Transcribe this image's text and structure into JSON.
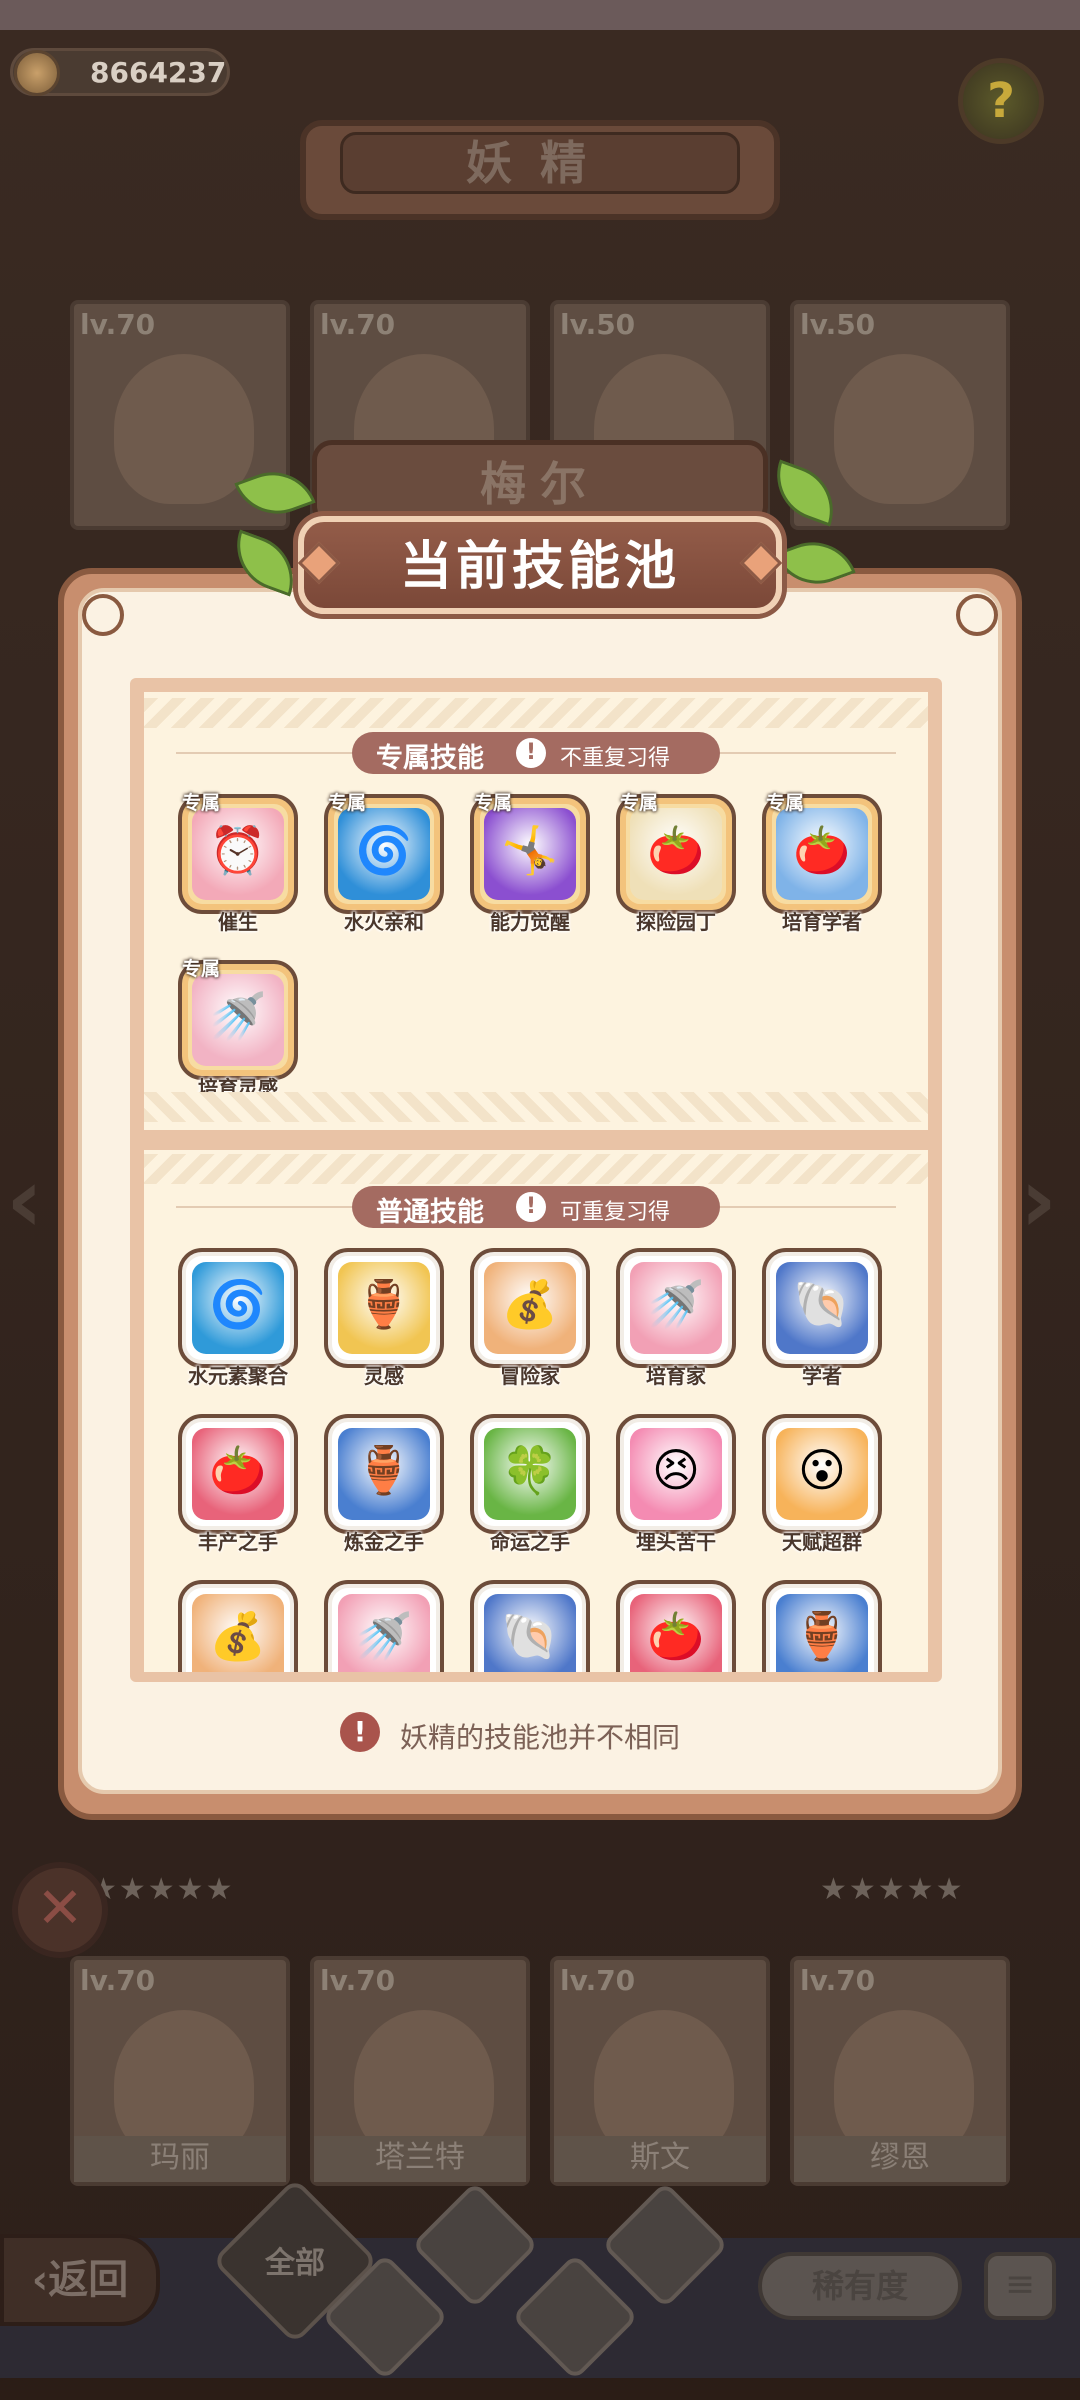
{
  "hud": {
    "coins": "8664237",
    "help_symbol": "?"
  },
  "bg_title": "妖精",
  "top_cards": [
    {
      "level": "lv.70"
    },
    {
      "level": "lv.70"
    },
    {
      "level": "lv.50"
    },
    {
      "level": "lv.50"
    }
  ],
  "bottom_cards": [
    {
      "level": "lv.70",
      "name": "玛丽"
    },
    {
      "level": "lv.70",
      "name": "塔兰特"
    },
    {
      "level": "lv.70",
      "name": "斯文"
    },
    {
      "level": "lv.70",
      "name": "缪恩"
    }
  ],
  "selected_fairy_name": "梅尔",
  "dialog": {
    "title": "当前技能池",
    "exclusive": {
      "heading": "专属技能",
      "note": "不重复习得",
      "tag": "专属",
      "skills": [
        {
          "name": "催生",
          "icon": "alarm-clock-icon",
          "color": "#f3a9b8",
          "glyph": "⏰"
        },
        {
          "name": "水火亲和",
          "icon": "water-fire-swirl-icon",
          "color": "#2f8fd8",
          "glyph": "🌀"
        },
        {
          "name": "能力觉醒",
          "icon": "awakening-figure-icon",
          "color": "#8b4fd0",
          "glyph": "🤸"
        },
        {
          "name": "探险园丁",
          "icon": "gardener-icon",
          "color": "#efe0b8",
          "glyph": "🍅"
        },
        {
          "name": "培育学者",
          "icon": "scholar-pot-icon",
          "color": "#7fb3e8",
          "glyph": "🍅"
        },
        {
          "name": "培育灵感",
          "icon": "watering-can-icon",
          "color": "#f2b3c4",
          "glyph": "🚿"
        }
      ]
    },
    "common": {
      "heading": "普通技能",
      "note": "可重复习得",
      "skills": [
        {
          "name": "水元素聚合",
          "icon": "water-swirl-icon",
          "color": "#2f9ad9",
          "glyph": "🌀"
        },
        {
          "name": "灵感",
          "icon": "treasure-pot-icon",
          "color": "#f1c552",
          "glyph": "🏺"
        },
        {
          "name": "冒险家",
          "icon": "adventurer-bag-icon",
          "color": "#f0b27a",
          "glyph": "💰"
        },
        {
          "name": "培育家",
          "icon": "watering-can-icon",
          "color": "#f2a0b5",
          "glyph": "🚿"
        },
        {
          "name": "学者",
          "icon": "scholar-shell-icon",
          "color": "#4f77c9",
          "glyph": "🐚"
        },
        {
          "name": "丰产之手",
          "icon": "tomato-icon",
          "color": "#e8637a",
          "glyph": "🍅"
        },
        {
          "name": "炼金之手",
          "icon": "alchemy-pot-icon",
          "color": "#4a7fd0",
          "glyph": "🏺"
        },
        {
          "name": "命运之手",
          "icon": "clover-icon",
          "color": "#69b545",
          "glyph": "🍀"
        },
        {
          "name": "埋头苦干",
          "icon": "hardwork-face-icon",
          "color": "#f48bb2",
          "glyph": "😣"
        },
        {
          "name": "天赋超群",
          "icon": "talent-face-icon",
          "color": "#f7b35a",
          "glyph": "😮"
        },
        {
          "name": "",
          "icon": "adventurer-bag-icon",
          "color": "#f0b27a",
          "glyph": "💰"
        },
        {
          "name": "",
          "icon": "watering-can-icon",
          "color": "#f2a0b5",
          "glyph": "🚿"
        },
        {
          "name": "",
          "icon": "scholar-shell-icon",
          "color": "#4f77c9",
          "glyph": "🐚"
        },
        {
          "name": "",
          "icon": "tomato-icon",
          "color": "#e8637a",
          "glyph": "🍅"
        },
        {
          "name": "",
          "icon": "alchemy-pot-icon",
          "color": "#4a7fd0",
          "glyph": "🏺"
        }
      ]
    },
    "footer_note": "妖精的技能池并不相同"
  },
  "footer": {
    "back_label": "返回",
    "filter_all_label": "全部",
    "rarity_label": "稀有度",
    "sort_glyph": "≡"
  },
  "stars": "★★★★★"
}
